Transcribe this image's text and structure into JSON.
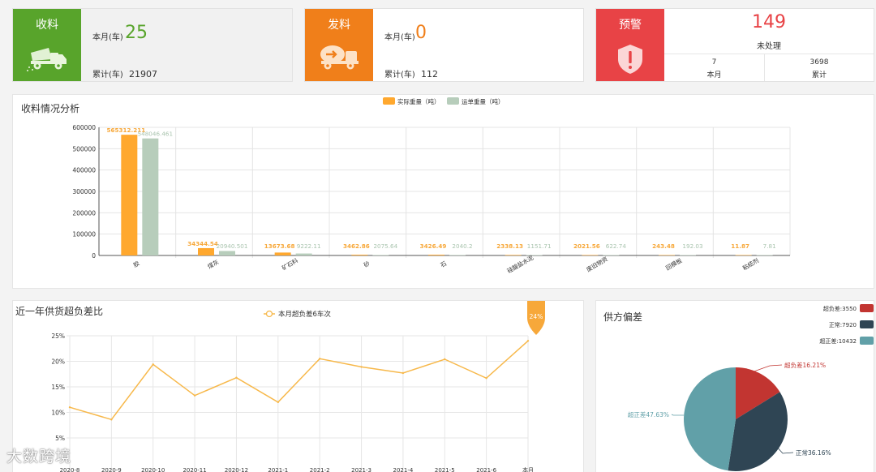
{
  "receive_card": {
    "title": "收料",
    "icon": "dump-truck-icon",
    "month_label": "本月(车)",
    "month_value": "25",
    "total_label": "累计(车)",
    "total_value": "21907",
    "color": "#58a42b"
  },
  "ship_card": {
    "title": "发料",
    "icon": "mixer-truck-icon",
    "month_label": "本月(车)",
    "month_value": "0",
    "total_label": "累计(车)",
    "total_value": "112",
    "color": "#f07f1a"
  },
  "warn_card": {
    "title": "预警",
    "icon": "shield-alert-icon",
    "count": "149",
    "count_label": "未处理",
    "month_value": "7",
    "month_label": "本月",
    "total_value": "3698",
    "total_label": "累计",
    "color": "#e84346"
  },
  "receive_analysis": {
    "title": "收料情况分析",
    "legend": [
      {
        "name": "实际重量（吨）",
        "color": "#ffa82e"
      },
      {
        "name": "运单重量（吨）",
        "color": "#b7cdbb"
      }
    ]
  },
  "trend_panel": {
    "title": "近一年供货超负差比",
    "legend": "本月超负差6车次",
    "pin_label": "24%"
  },
  "supplier_panel": {
    "title": "供方偏差",
    "legend": [
      {
        "name": "超负差:3550",
        "color": "#c23531"
      },
      {
        "name": "正常:7920",
        "color": "#2f4554"
      },
      {
        "name": "超正差:10432",
        "color": "#61a0a8"
      }
    ]
  },
  "watermark": "大数跨境",
  "chart_data": [
    {
      "type": "bar",
      "title": "收料情况分析",
      "categories": [
        "胶",
        "煤灰",
        "矿石料",
        "砂",
        "石",
        "硅酸盐水泥",
        "废旧物资",
        "回模板",
        "粘结剂"
      ],
      "series": [
        {
          "name": "实际重量（吨）",
          "values": [
            565312.211,
            34344.54,
            13673.68,
            3462.86,
            3426.49,
            2338.13,
            2021.56,
            243.48,
            11.87
          ]
        },
        {
          "name": "运单重量（吨）",
          "values": [
            548046.461,
            20940.501,
            9222.11,
            2075.64,
            2040.2,
            1151.71,
            622.74,
            192.03,
            7.81
          ]
        }
      ],
      "value_labels": [
        [
          "565312.211",
          "34344.54",
          "13673.68",
          "3462.86",
          "3426.49",
          "2338.13",
          "2021.56",
          "243.48",
          "11.87"
        ],
        [
          "548046.461",
          "20940.501",
          "9222.11",
          "2075.64",
          "2040.2",
          "1151.71",
          "622.74",
          "192.03",
          "7.81"
        ]
      ],
      "ylim": [
        0,
        600000
      ],
      "yticks": [
        0,
        100000,
        200000,
        300000,
        400000,
        500000,
        600000
      ],
      "grid": true,
      "legend_position": "top-center"
    },
    {
      "type": "line",
      "title": "近一年供货超负差比",
      "categories": [
        "2020-8",
        "2020-9",
        "2020-10",
        "2020-11",
        "2020-12",
        "2021-1",
        "2021-2",
        "2021-3",
        "2021-4",
        "2021-5",
        "2021-6",
        "本月"
      ],
      "series": [
        {
          "name": "本月超负差6车次",
          "values": [
            11,
            8.6,
            19.4,
            13.3,
            16.8,
            12,
            20.5,
            18.9,
            17.7,
            20.4,
            16.7,
            24
          ],
          "color": "#f7b84a"
        }
      ],
      "ylim": [
        0,
        25
      ],
      "yticks": [
        "5%",
        "10%",
        "15%",
        "20%",
        "25%"
      ],
      "grid": true,
      "legend_position": "top-center"
    },
    {
      "type": "pie",
      "title": "供方偏差",
      "slices": [
        {
          "name": "超负差",
          "value": 3550,
          "label": "超负差16.21%",
          "color": "#c23531"
        },
        {
          "name": "正常",
          "value": 7920,
          "label": "正常36.16%",
          "color": "#2f4554"
        },
        {
          "name": "超正差",
          "value": 10432,
          "label": "超正差47.63%",
          "color": "#61a0a8"
        }
      ],
      "legend_position": "top-right"
    }
  ]
}
